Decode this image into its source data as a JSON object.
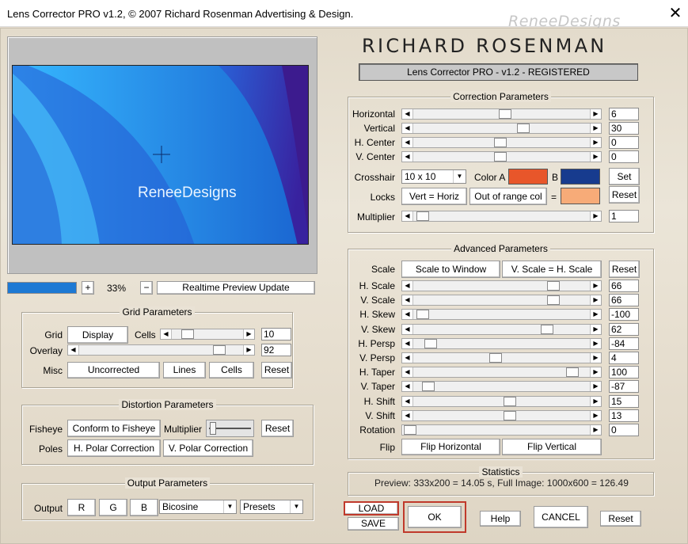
{
  "window": {
    "title": "Lens Corrector PRO v1.2, © 2007 Richard Rosenman Advertising & Design.",
    "watermark": "ReneeDesigns",
    "close": "✕"
  },
  "brand": {
    "name": "RICHARD ROSENMAN",
    "version": "Lens Corrector PRO - v1.2 - REGISTERED"
  },
  "preview": {
    "watermark": "ReneeDesigns",
    "zoom": "33%",
    "plus": "+",
    "minus": "−",
    "realtime": "Realtime  Preview  Update",
    "progress": 1.0
  },
  "grid": {
    "title": "Grid Parameters",
    "grid_label": "Grid",
    "display": "Display",
    "cells_label": "Cells",
    "cells_value": "10",
    "overlay_label": "Overlay",
    "overlay_value": "92",
    "misc_label": "Misc",
    "uncorrected": "Uncorrected",
    "lines": "Lines",
    "cells": "Cells",
    "reset": "Reset"
  },
  "distortion": {
    "title": "Distortion Parameters",
    "fisheye_label": "Fisheye",
    "conform": "Conform to Fisheye",
    "multiplier_label": "Multiplier",
    "reset": "Reset",
    "poles_label": "Poles",
    "hpolar": "H. Polar Correction",
    "vpolar": "V. Polar Correction"
  },
  "output": {
    "title": "Output Parameters",
    "label": "Output",
    "r": "R",
    "g": "G",
    "b": "B",
    "interp": "Bicosine",
    "presets": "Presets"
  },
  "correction": {
    "title": "Correction Parameters",
    "rows": [
      {
        "label": "Horizontal",
        "value": "6"
      },
      {
        "label": "Vertical",
        "value": "30"
      },
      {
        "label": "H. Center",
        "value": "0"
      },
      {
        "label": "V. Center",
        "value": "0"
      }
    ],
    "crosshair_label": "Crosshair",
    "crosshair_value": "10 x 10",
    "color_a_label": "Color A",
    "b_label": "B",
    "color_a": "#e8562a",
    "color_b": "#173b8e",
    "set": "Set",
    "locks_label": "Locks",
    "vert_horiz": "Vert = Horiz",
    "out_of_range": "Out of range col",
    "eq": "=",
    "out_color": "#f7ab78",
    "reset": "Reset",
    "multiplier_label": "Multiplier",
    "multiplier_value": "1"
  },
  "advanced": {
    "title": "Advanced Parameters",
    "scale_label": "Scale",
    "scale_to_window": "Scale to Window",
    "vscale_hscale": "V. Scale = H. Scale",
    "reset": "Reset",
    "rows": [
      {
        "label": "H. Scale",
        "value": "66"
      },
      {
        "label": "V. Scale",
        "value": "66"
      },
      {
        "label": "H. Skew",
        "value": "-100"
      },
      {
        "label": "V. Skew",
        "value": "62"
      },
      {
        "label": "H. Persp",
        "value": "-84"
      },
      {
        "label": "V. Persp",
        "value": "4"
      },
      {
        "label": "H. Taper",
        "value": "100"
      },
      {
        "label": "V. Taper",
        "value": "-87"
      },
      {
        "label": "H. Shift",
        "value": "15"
      },
      {
        "label": "V. Shift",
        "value": "13"
      },
      {
        "label": "Rotation",
        "value": "0"
      }
    ],
    "flip_label": "Flip",
    "flip_h": "Flip Horizontal",
    "flip_v": "Flip Vertical"
  },
  "stats": {
    "title": "Statistics",
    "text": "Preview: 333x200 = 14.05 s,   Full Image: 1000x600 = 126.49"
  },
  "actions": {
    "load": "LOAD",
    "save": "SAVE",
    "ok": "OK",
    "help": "Help",
    "cancel": "CANCEL",
    "reset": "Reset"
  }
}
